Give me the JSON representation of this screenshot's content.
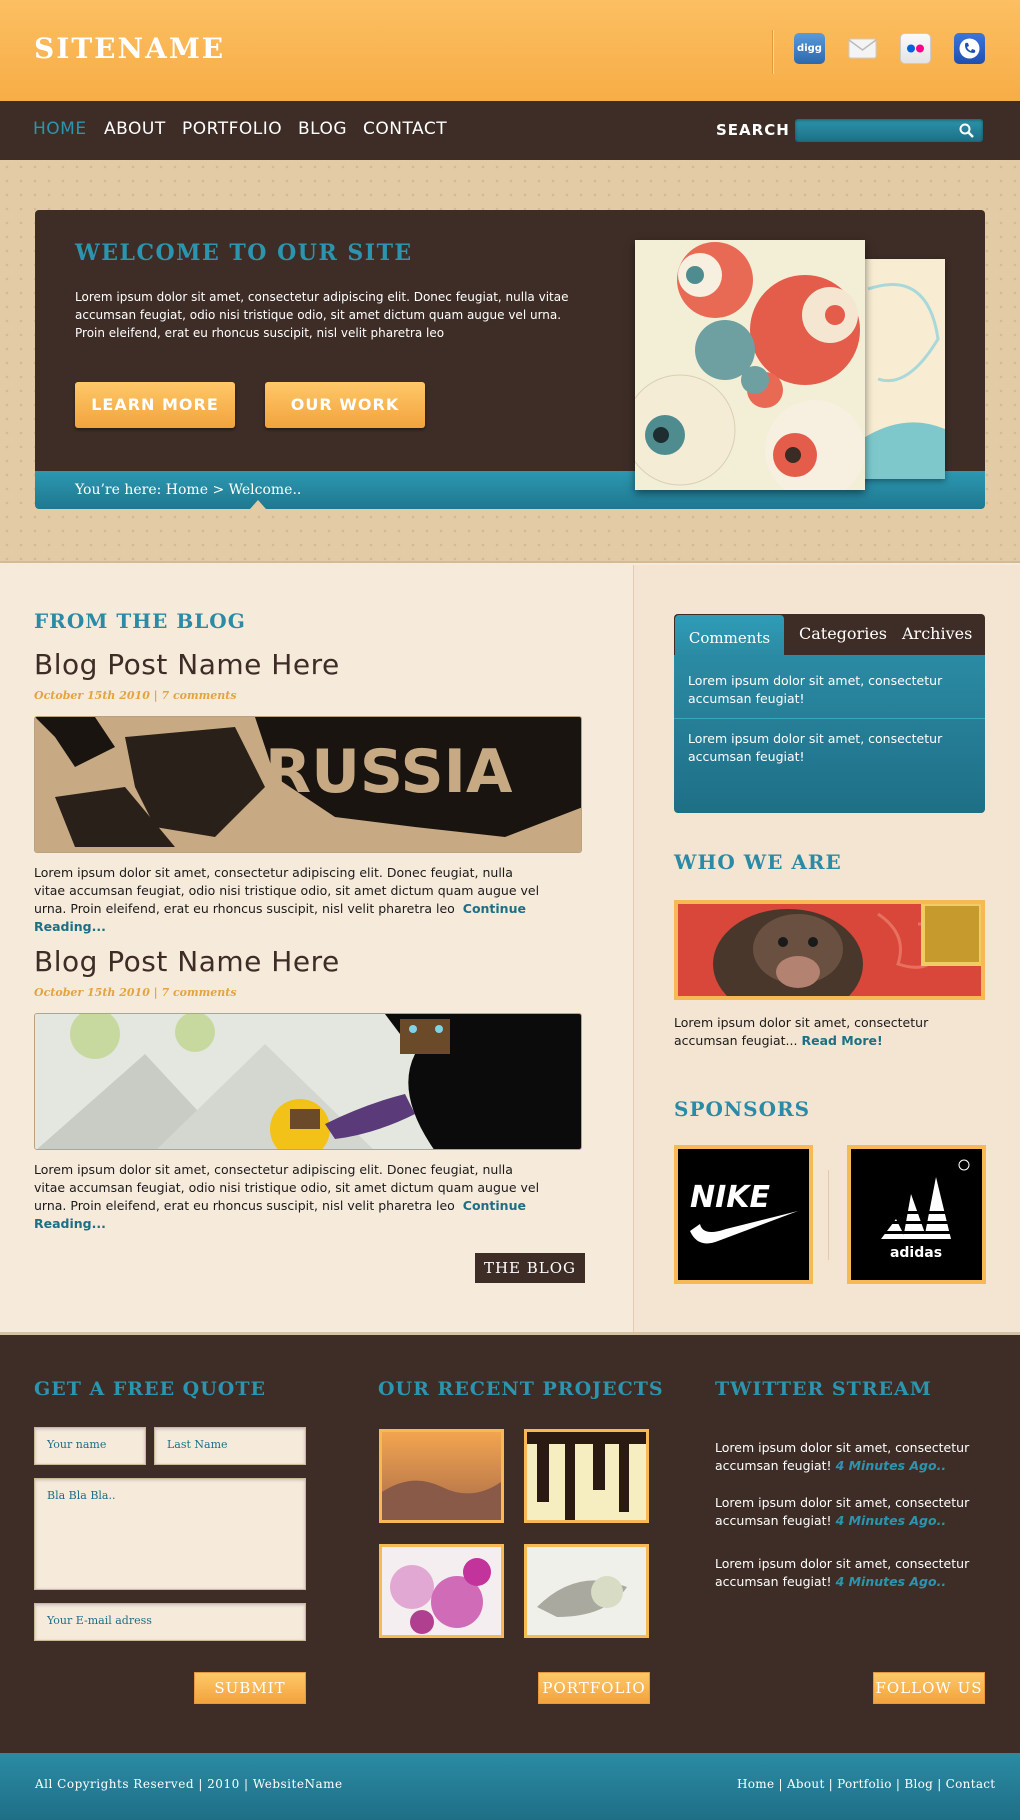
{
  "header": {
    "sitename": "SITENAME"
  },
  "social": [
    "digg-icon",
    "mail-icon",
    "flickr-icon",
    "skype-icon"
  ],
  "nav": {
    "items": [
      "HOME",
      "ABOUT",
      "PORTFOLIO",
      "BLOG",
      "CONTACT"
    ],
    "active": "HOME",
    "search_label": "SEARCH"
  },
  "hero": {
    "title": "WELCOME TO OUR SITE",
    "text": "Lorem ipsum dolor sit amet, consectetur adipiscing elit. Donec feugiat, nulla vitae accumsan feugiat, odio nisi tristique odio, sit amet dictum quam augue vel urna. Proin eleifend, erat eu rhoncus suscipit, nisl velit pharetra leo",
    "btn_learn": "LEARN MORE",
    "btn_work": "OUR WORK",
    "breadcrumb": "You’re here: Home > Welcome.."
  },
  "blog": {
    "section_title": "FROM THE BLOG",
    "posts": [
      {
        "title": "Blog Post Name Here",
        "meta": "October 15th 2010 | 7 comments",
        "text": "Lorem ipsum dolor sit amet, consectetur adipiscing elit. Donec feugiat, nulla vitae accumsan feugiat, odio nisi tristique odio, sit amet dictum quam augue vel urna. Proin eleifend, erat eu rhoncus suscipit, nisl velit pharetra leo",
        "more": "Continue Reading..."
      },
      {
        "title": "Blog Post Name Here",
        "meta": "October 15th 2010 | 7 comments",
        "text": "Lorem ipsum dolor sit amet, consectetur adipiscing elit. Donec feugiat, nulla vitae accumsan feugiat, odio nisi tristique odio, sit amet dictum quam augue vel urna. Proin eleifend, erat eu rhoncus suscipit, nisl velit pharetra leo",
        "more": "Continue Reading..."
      }
    ],
    "button": "THE BLOG"
  },
  "sidebar": {
    "tabs": [
      "Comments",
      "Categories",
      "Archives"
    ],
    "active_tab": "Comments",
    "comments": [
      "Lorem ipsum dolor sit amet, consectetur accumsan feugiat!",
      "Lorem ipsum dolor sit amet, consectetur accumsan feugiat!"
    ],
    "who_title": "WHO WE ARE",
    "who_text": "Lorem ipsum dolor sit amet, consectetur accumsan feugiat...",
    "who_more": "Read More!",
    "sponsors_title": "SPONSORS",
    "sponsors": [
      "NIKE",
      "adidas"
    ]
  },
  "footer": {
    "quote_title": "GET A FREE QUOTE",
    "placeholders": {
      "first": "Your name",
      "last": "Last Name",
      "message": "Bla Bla Bla..",
      "email": "Your E-mail adress"
    },
    "submit": "SUBMIT",
    "projects_title": "OUR RECENT PROJECTS",
    "portfolio_btn": "PORTFOLIO",
    "twitter_title": "TWITTER STREAM",
    "tweets": [
      {
        "text": "Lorem ipsum dolor sit amet, consectetur accumsan feugiat!",
        "ago": "4 Minutes Ago.."
      },
      {
        "text": "Lorem ipsum dolor sit amet, consectetur accumsan feugiat!",
        "ago": "4 Minutes Ago.."
      },
      {
        "text": "Lorem ipsum dolor sit amet, consectetur accumsan feugiat!",
        "ago": "4 Minutes Ago.."
      }
    ],
    "follow_btn": "FOLLOW US",
    "copyright": "All Copyrights Reserved | 2010 | WebsiteName",
    "links": "Home | About | Portfolio | Blog | Contact"
  },
  "colors": {
    "accent": "#2b95af",
    "orange": "#f7b955",
    "dark": "#3e2d26",
    "cream": "#f6eadb"
  }
}
